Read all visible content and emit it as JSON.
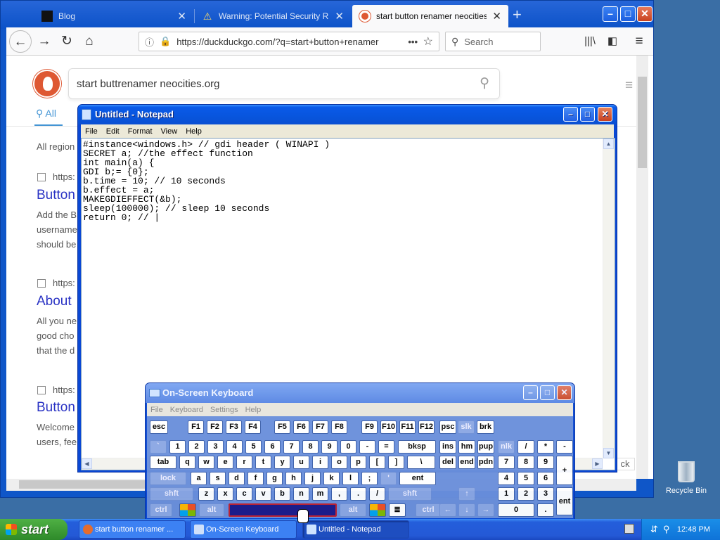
{
  "browser": {
    "tabs": [
      {
        "label": "Blog",
        "active": false
      },
      {
        "label": "Warning: Potential Security Risk Ah",
        "active": false
      },
      {
        "label": "start button renamer neocities.org",
        "active": true
      }
    ],
    "new_tab_label": "+",
    "url": "https://duckduckgo.com/?q=start+button+renamer",
    "url_dots": "•••",
    "search_placeholder": "Search"
  },
  "ddg": {
    "query": "start buttrenamer neocities.org",
    "tab_all": "All",
    "region": "All region",
    "results": [
      {
        "url": "https:",
        "title": "Button",
        "snippet": [
          "Add the B",
          "username",
          "should be"
        ]
      },
      {
        "url": "https:",
        "title": "About",
        "snippet": [
          "All you ne",
          "good cho",
          "that the d"
        ]
      },
      {
        "url": "https:",
        "title": "Button",
        "snippet": [
          "Welcome",
          "users, fee"
        ]
      }
    ],
    "peek": "ck"
  },
  "notepad": {
    "title": "Untitled - Notepad",
    "menu": [
      "File",
      "Edit",
      "Format",
      "View",
      "Help"
    ],
    "text": "#instance<windows.h> // gdi header ( WINAPI )\nSECRET a; //the effect function\nint main(a) {\nGDI b;= {0};\nb.time = 10; // 10 seconds\nb.effect = a;\nMAKEGDIEFFECT(&b);\nsleep(100000); // sleep 10 seconds\nreturn 0; // |"
  },
  "osk": {
    "title": "On-Screen Keyboard",
    "menu": [
      "File",
      "Keyboard",
      "Settings",
      "Help"
    ],
    "rows": [
      [
        "esc",
        "F1",
        "F2",
        "F3",
        "F4",
        "F5",
        "F6",
        "F7",
        "F8",
        "F9",
        "F10",
        "F11",
        "F12",
        "psc",
        "slk",
        "brk"
      ],
      [
        "`",
        "1",
        "2",
        "3",
        "4",
        "5",
        "6",
        "7",
        "8",
        "9",
        "0",
        "-",
        "=",
        "bksp",
        "ins",
        "hm",
        "pup",
        "nlk",
        "/",
        "*",
        "-"
      ],
      [
        "tab",
        "q",
        "w",
        "e",
        "r",
        "t",
        "y",
        "u",
        "i",
        "o",
        "p",
        "[",
        "]",
        "\\",
        "del",
        "end",
        "pdn",
        "7",
        "8",
        "9",
        "+"
      ],
      [
        "lock",
        "a",
        "s",
        "d",
        "f",
        "g",
        "h",
        "j",
        "k",
        "l",
        ";",
        "'",
        "ent",
        "4",
        "5",
        "6"
      ],
      [
        "shft",
        "z",
        "x",
        "c",
        "v",
        "b",
        "n",
        "m",
        ",",
        ".",
        "/",
        "shft",
        "↑",
        "1",
        "2",
        "3",
        "ent"
      ],
      [
        "ctrl",
        "alt",
        "alt",
        "ctrl",
        "←",
        "↓",
        "→",
        "0",
        "."
      ]
    ]
  },
  "desktop": {
    "recycle_bin": "Recycle Bin"
  },
  "taskbar": {
    "start": "start",
    "items": [
      {
        "label": "start button renamer ...",
        "active": false
      },
      {
        "label": "On-Screen Keyboard",
        "active": false
      },
      {
        "label": "Untitled - Notepad",
        "active": true
      }
    ],
    "clock": "12:48 PM"
  },
  "colors": {
    "xp_blue": "#0a48d4",
    "ddg_orange": "#de5833",
    "link_blue": "#2a33c4",
    "taskbar": "#245edb"
  }
}
